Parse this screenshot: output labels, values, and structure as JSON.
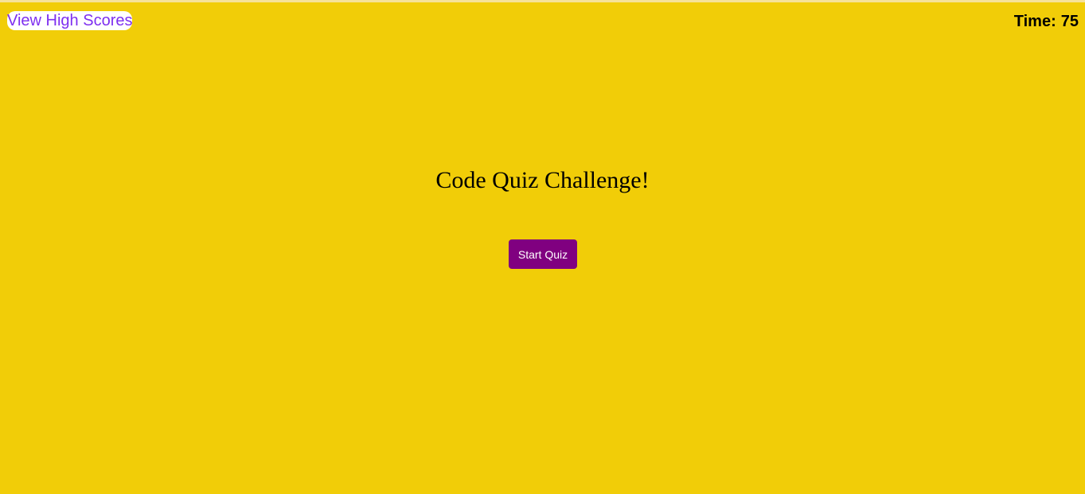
{
  "header": {
    "high_scores_label": "View High Scores",
    "timer_label": "Time:",
    "timer_value": "75"
  },
  "main": {
    "title": "Code Quiz Challenge!",
    "start_button_label": "Start Quiz"
  },
  "colors": {
    "background": "#f1cd08",
    "link": "#7e2ff0",
    "button": "#800080",
    "button_text": "#ffffff"
  }
}
